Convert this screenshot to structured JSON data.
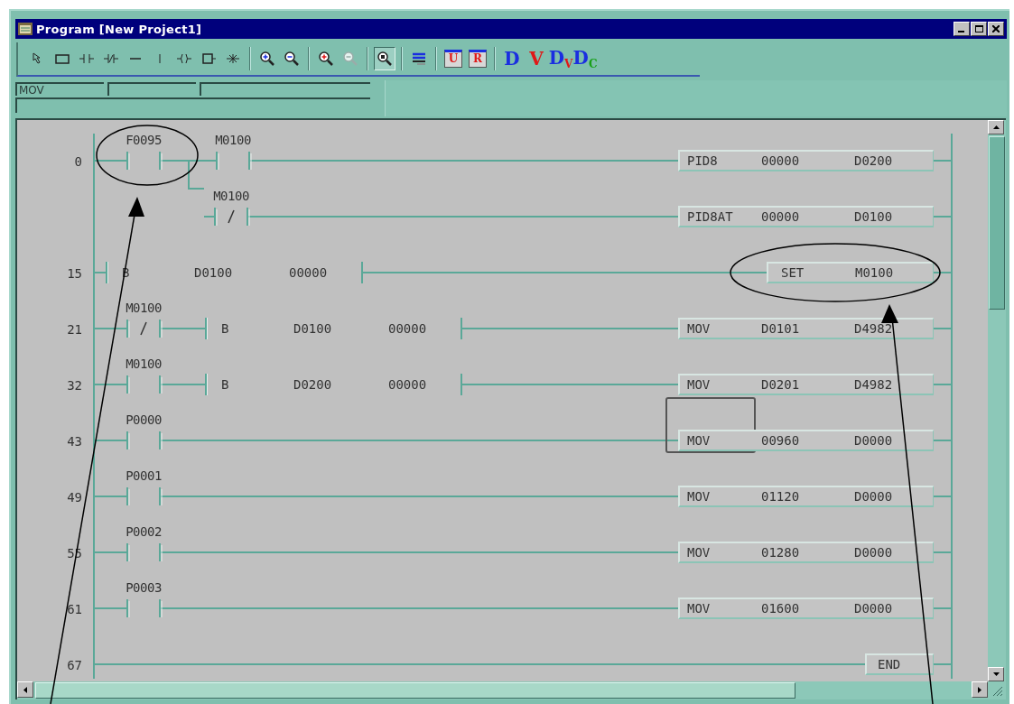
{
  "window": {
    "title": "Program [New Project1]"
  },
  "toolbar": {
    "groups": [
      [
        {
          "kind": "pointer",
          "selected": false,
          "disabled": false
        },
        {
          "kind": "rect",
          "selected": false,
          "disabled": false
        },
        {
          "kind": "contact",
          "selected": false,
          "disabled": false
        },
        {
          "kind": "contact_nc",
          "selected": false,
          "disabled": false
        },
        {
          "kind": "hline",
          "selected": false,
          "disabled": false
        },
        {
          "kind": "vline",
          "selected": false,
          "disabled": false
        },
        {
          "kind": "coil",
          "selected": false,
          "disabled": false
        },
        {
          "kind": "func_box",
          "selected": false,
          "disabled": false
        },
        {
          "kind": "junction",
          "selected": false,
          "disabled": false
        }
      ],
      [
        {
          "kind": "zoom_in",
          "selected": false,
          "disabled": false
        },
        {
          "kind": "zoom_out",
          "selected": false,
          "disabled": false
        }
      ],
      [
        {
          "kind": "zoom_in_red",
          "selected": false,
          "disabled": false
        },
        {
          "kind": "zoom_out",
          "selected": false,
          "disabled": true
        }
      ],
      [
        {
          "kind": "zoom_fit",
          "selected": true,
          "disabled": false
        }
      ],
      [
        {
          "kind": "bars",
          "selected": false,
          "disabled": false
        }
      ],
      [
        {
          "kind": "boxed_letter",
          "label": "U",
          "selected": false,
          "disabled": false
        },
        {
          "kind": "boxed_letter",
          "label": "R",
          "selected": false,
          "disabled": false
        }
      ],
      [
        {
          "kind": "letter",
          "label": "D",
          "color": "#1a2ee0",
          "selected": false,
          "disabled": false
        },
        {
          "kind": "letter",
          "label": "V",
          "color": "#e01818",
          "selected": false,
          "disabled": false
        },
        {
          "kind": "letter",
          "label": "D",
          "sub": {
            "label": "V",
            "color": "#e01818"
          },
          "color": "#1a2ee0",
          "selected": false,
          "disabled": false
        },
        {
          "kind": "letter",
          "label": "D",
          "sub": {
            "label": "C",
            "color": "#18a018"
          },
          "color": "#1a2ee0",
          "selected": false,
          "disabled": false
        }
      ]
    ]
  },
  "input_bar": {
    "instruction": "MOV"
  },
  "ladder": {
    "rungs": [
      {
        "step": "0",
        "elements": [
          {
            "kind": "contact",
            "operand": "F0095"
          },
          {
            "kind": "contact",
            "operand": "M0100"
          }
        ],
        "instruction": {
          "parts": [
            "PID8",
            "00000",
            "D0200"
          ],
          "cursor": false
        },
        "branch": {
          "elements": [
            {
              "kind": "contact_nc",
              "operand": "M0100"
            }
          ],
          "instruction": {
            "parts": [
              "PID8AT",
              "00000",
              "D0100"
            ],
            "cursor": false
          }
        }
      },
      {
        "step": "15",
        "elements": [
          {
            "kind": "compare",
            "parts": [
              "B",
              "D0100",
              "00000"
            ]
          }
        ],
        "instruction": {
          "parts": [
            "SET",
            "M0100"
          ],
          "cursor": false
        }
      },
      {
        "step": "21",
        "elements": [
          {
            "kind": "contact_nc",
            "operand": "M0100"
          },
          {
            "kind": "compare",
            "parts": [
              "B",
              "D0100",
              "00000"
            ]
          }
        ],
        "instruction": {
          "parts": [
            "MOV",
            "D0101",
            "D4982"
          ],
          "cursor": false
        }
      },
      {
        "step": "32",
        "elements": [
          {
            "kind": "contact",
            "operand": "M0100"
          },
          {
            "kind": "compare",
            "parts": [
              "B",
              "D0200",
              "00000"
            ]
          }
        ],
        "instruction": {
          "parts": [
            "MOV",
            "D0201",
            "D4982"
          ],
          "cursor": false
        }
      },
      {
        "step": "43",
        "elements": [
          {
            "kind": "contact",
            "operand": "P0000"
          }
        ],
        "instruction": {
          "parts": [
            "MOV",
            "00960",
            "D0000"
          ],
          "cursor": true
        }
      },
      {
        "step": "49",
        "elements": [
          {
            "kind": "contact",
            "operand": "P0001"
          }
        ],
        "instruction": {
          "parts": [
            "MOV",
            "01120",
            "D0000"
          ],
          "cursor": false
        }
      },
      {
        "step": "55",
        "elements": [
          {
            "kind": "contact",
            "operand": "P0002"
          }
        ],
        "instruction": {
          "parts": [
            "MOV",
            "01280",
            "D0000"
          ],
          "cursor": false
        }
      },
      {
        "step": "61",
        "elements": [
          {
            "kind": "contact",
            "operand": "P0003"
          }
        ],
        "instruction": {
          "parts": [
            "MOV",
            "01600",
            "D0000"
          ],
          "cursor": false
        }
      },
      {
        "step": "67",
        "instruction": {
          "parts": [
            "END"
          ],
          "cursor": false
        }
      }
    ]
  }
}
